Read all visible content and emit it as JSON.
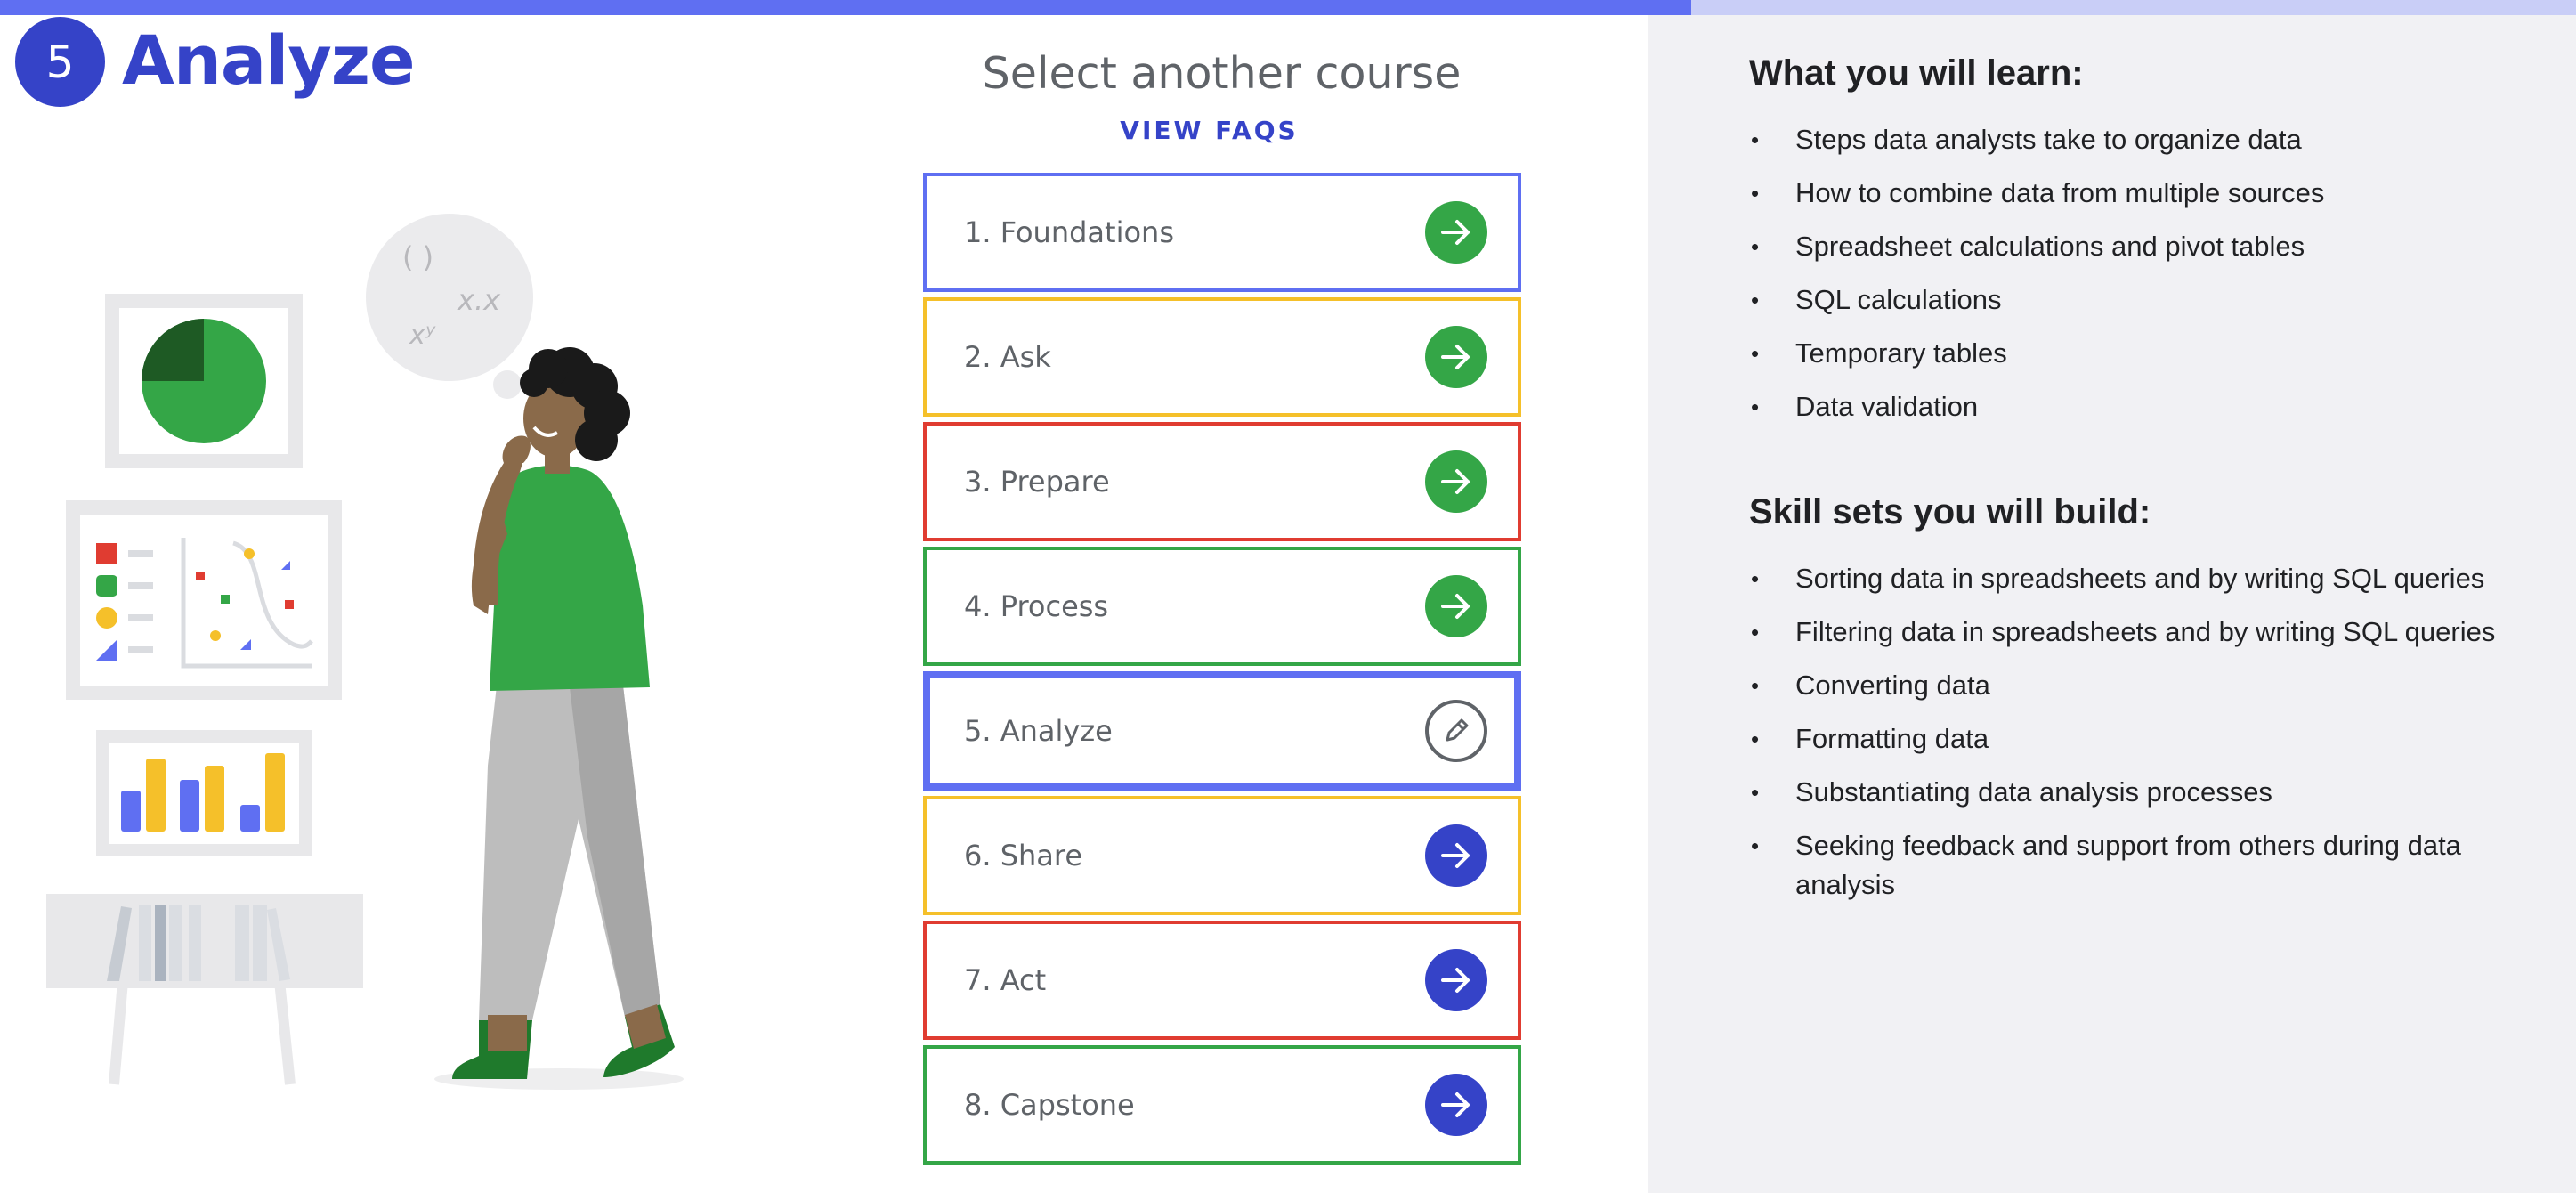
{
  "progress": {
    "fraction": 0.625
  },
  "header": {
    "step_number": "5",
    "title": "Analyze"
  },
  "course_selector": {
    "title": "Select another course",
    "faq_link": "VIEW FAQS",
    "courses": [
      {
        "label": "1. Foundations",
        "border_color": "#5f6ff2",
        "status": "done",
        "icon": "arrow-right-icon"
      },
      {
        "label": "2. Ask",
        "border_color": "#f5c02a",
        "status": "done",
        "icon": "arrow-right-icon"
      },
      {
        "label": "3. Prepare",
        "border_color": "#e03c31",
        "status": "done",
        "icon": "arrow-right-icon"
      },
      {
        "label": "4. Process",
        "border_color": "#34a647",
        "status": "done",
        "icon": "arrow-right-icon"
      },
      {
        "label": "5. Analyze",
        "border_color": "#5f6ff2",
        "status": "current",
        "icon": "pencil-icon"
      },
      {
        "label": "6. Share",
        "border_color": "#f5c02a",
        "status": "todo",
        "icon": "arrow-right-icon"
      },
      {
        "label": "7. Act",
        "border_color": "#e03c31",
        "status": "todo",
        "icon": "arrow-right-icon"
      },
      {
        "label": "8. Capstone",
        "border_color": "#34a647",
        "status": "todo",
        "icon": "arrow-right-icon"
      }
    ]
  },
  "learn": {
    "heading": "What you will learn:",
    "items": [
      "Steps data analysts take to organize data",
      "How to combine data from multiple sources",
      "Spreadsheet calculations and pivot tables",
      "SQL calculations",
      "Temporary tables",
      "Data validation"
    ]
  },
  "skills": {
    "heading": "Skill sets you will build:",
    "items": [
      "Sorting data in spreadsheets and by writing SQL queries",
      "Filtering data in spreadsheets and by writing SQL queries",
      "Converting data",
      "Formatting data",
      "Substantiating data analysis processes",
      "Seeking feedback and support from others during data analysis"
    ]
  },
  "illustration": {
    "thought_bubble": [
      "( )",
      "x.x",
      "xʸ"
    ]
  },
  "colors": {
    "brand_blue": "#3543c8",
    "accent_blue": "#5f6ff2",
    "green": "#34a647",
    "yellow": "#f5c02a",
    "red": "#e03c31",
    "panel_bg": "#f1f1f4"
  }
}
